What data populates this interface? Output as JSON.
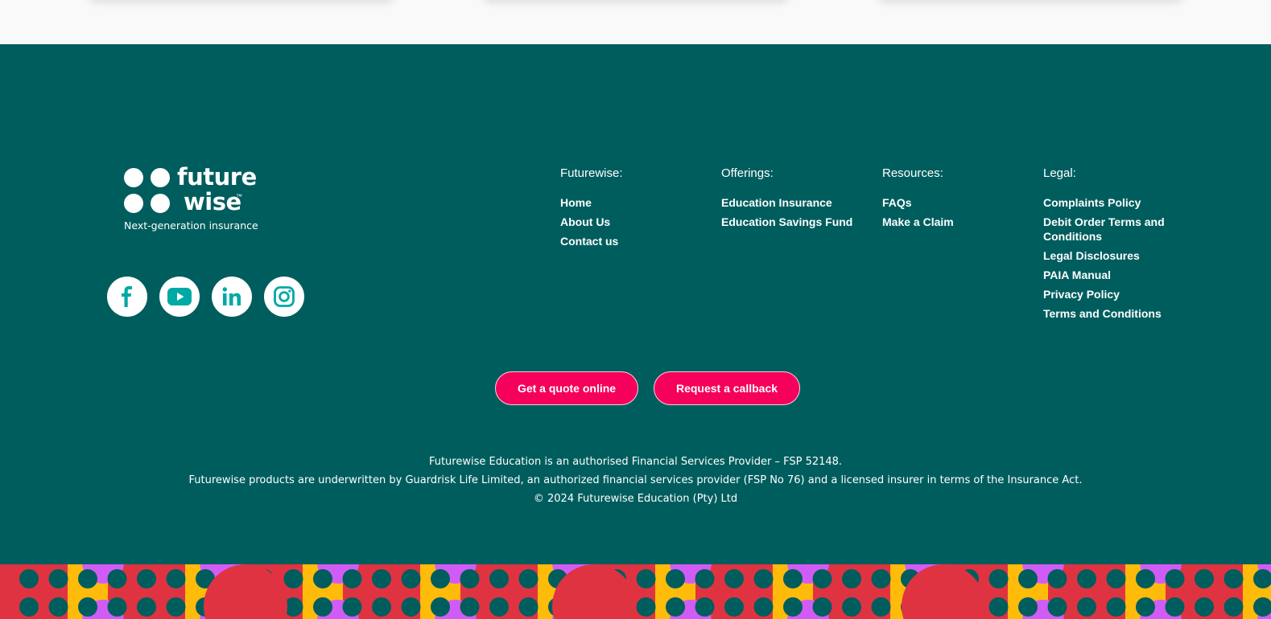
{
  "brand": {
    "name_line1": "future",
    "name_line2": "wise",
    "trademark": "™",
    "tagline": "Next-generation insurance"
  },
  "social": [
    {
      "name": "facebook-icon"
    },
    {
      "name": "youtube-icon"
    },
    {
      "name": "linkedin-icon"
    },
    {
      "name": "instagram-icon"
    }
  ],
  "columns": {
    "futurewise": {
      "title": "Futurewise:",
      "links": [
        "Home",
        "About Us",
        "Contact us"
      ]
    },
    "offerings": {
      "title": "Offerings:",
      "links": [
        "Education Insurance",
        "Education Savings Fund"
      ]
    },
    "resources": {
      "title": "Resources:",
      "links": [
        "FAQs",
        "Make a Claim"
      ]
    },
    "legal": {
      "title": "Legal:",
      "links": [
        "Complaints Policy",
        "Debit Order Terms and Conditions",
        "Legal Disclosures",
        "PAIA Manual",
        "Privacy Policy",
        "Terms and Conditions"
      ]
    }
  },
  "cta": {
    "quote_label": "Get a quote online",
    "callback_label": "Request a callback"
  },
  "disclaimer": {
    "line1": "Futurewise Education is an authorised Financial Services Provider – FSP 52148.",
    "line2": "Futurewise products are underwritten by Guardrisk Life Limited, an authorized financial services provider (FSP No 76) and a licensed insurer in terms of the Insurance Act.",
    "line3": "© 2024 Futurewise Education (Pty) Ltd"
  },
  "colors": {
    "footer_bg": "#005d5e",
    "accent": "#f5005a",
    "icon": "#00a9a4",
    "pattern_red": "#e03341",
    "pattern_purple": "#d15cf5",
    "pattern_yellow": "#ffbb0a"
  }
}
